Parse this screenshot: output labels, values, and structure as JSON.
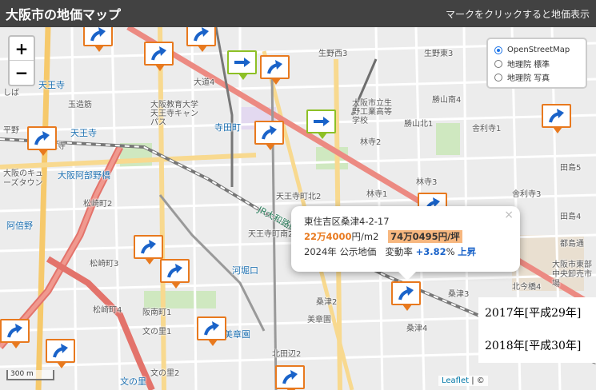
{
  "header": {
    "title": "大阪市の地価マップ",
    "hint": "マークをクリックすると地価表示"
  },
  "zoom": {
    "in_label": "+",
    "out_label": "−"
  },
  "layers": {
    "options": [
      "OpenStreetMap",
      "地理院 標準",
      "地理院 写真"
    ],
    "selected": "OpenStreetMap"
  },
  "map_labels": [
    {
      "text": "天王寺",
      "kind": "station"
    },
    {
      "text": "天王寺",
      "kind": "station"
    },
    {
      "text": "大阪阿部野橋",
      "kind": "station"
    },
    {
      "text": "寺田町",
      "kind": "station"
    },
    {
      "text": "河堀口",
      "kind": "station"
    },
    {
      "text": "美章園",
      "kind": "station"
    },
    {
      "text": "文の里",
      "kind": "station"
    },
    {
      "text": "阿倍野",
      "kind": "station"
    },
    {
      "text": "生野西3",
      "kind": "place"
    },
    {
      "text": "生野東3",
      "kind": "place"
    },
    {
      "text": "大道4",
      "kind": "place"
    },
    {
      "text": "玉造筋",
      "kind": "place"
    },
    {
      "text": "大阪教育大学 天王寺キャンパス",
      "kind": "place"
    },
    {
      "text": "大阪市立生野工業高等学校",
      "kind": "place"
    },
    {
      "text": "天王寺町北2",
      "kind": "place"
    },
    {
      "text": "天王寺町南2",
      "kind": "place"
    },
    {
      "text": "松崎町2",
      "kind": "place"
    },
    {
      "text": "松崎町3",
      "kind": "place"
    },
    {
      "text": "松崎町4",
      "kind": "place"
    },
    {
      "text": "阪南町1",
      "kind": "place"
    },
    {
      "text": "北田辺2",
      "kind": "place"
    },
    {
      "text": "美章園",
      "kind": "place"
    },
    {
      "text": "文の里1",
      "kind": "place"
    },
    {
      "text": "文の里2",
      "kind": "place"
    },
    {
      "text": "桑津2",
      "kind": "place"
    },
    {
      "text": "桑津3",
      "kind": "place"
    },
    {
      "text": "桑津4",
      "kind": "place"
    },
    {
      "text": "林寺2",
      "kind": "place"
    },
    {
      "text": "林寺3",
      "kind": "place"
    },
    {
      "text": "林寺1",
      "kind": "place"
    },
    {
      "text": "勝山北1",
      "kind": "place"
    },
    {
      "text": "勝山南4",
      "kind": "place"
    },
    {
      "text": "舎利寺1",
      "kind": "place"
    },
    {
      "text": "舎利寺3",
      "kind": "place"
    },
    {
      "text": "田島5",
      "kind": "place"
    },
    {
      "text": "田島4",
      "kind": "place"
    },
    {
      "text": "都島通",
      "kind": "place"
    },
    {
      "text": "大阪市東部中央卸売市場",
      "kind": "place"
    },
    {
      "text": "北今橋4",
      "kind": "place"
    },
    {
      "text": "大阪のキューズタウン",
      "kind": "place"
    },
    {
      "text": "天王寺",
      "kind": "place"
    },
    {
      "text": "しば",
      "kind": "place"
    },
    {
      "text": "JR大和路線",
      "kind": "road"
    },
    {
      "text": "平野",
      "kind": "road"
    }
  ],
  "markers": [
    {
      "trend": "up"
    },
    {
      "trend": "up"
    },
    {
      "trend": "flat"
    },
    {
      "trend": "up"
    },
    {
      "trend": "up"
    },
    {
      "trend": "flat"
    },
    {
      "trend": "up"
    },
    {
      "trend": "up"
    },
    {
      "trend": "up"
    },
    {
      "trend": "up"
    },
    {
      "trend": "up"
    },
    {
      "trend": "up"
    },
    {
      "trend": "up"
    },
    {
      "trend": "up"
    },
    {
      "trend": "up"
    },
    {
      "trend": "up"
    },
    {
      "trend": "up"
    }
  ],
  "popup": {
    "address": "東住吉区桑津4-2-17",
    "price_m2": "22万4000",
    "unit_m2": "円/m2",
    "price_tsubo": "74万0495円/坪",
    "year": "2024年",
    "source": "公示地価",
    "change_label": "変動率",
    "change_value": "+3.82",
    "change_unit": "%",
    "trend_text": "上昇",
    "close": "×"
  },
  "scale": {
    "label": "300 m"
  },
  "attribution": {
    "leaflet": "Leaflet",
    "rest": " | ©"
  },
  "year_list": [
    "2017年[平成29年]",
    "2018年[平成30年]"
  ],
  "colors": {
    "up": "#e8791e",
    "flat": "#8dc026",
    "arrow": "#1a63c9"
  }
}
